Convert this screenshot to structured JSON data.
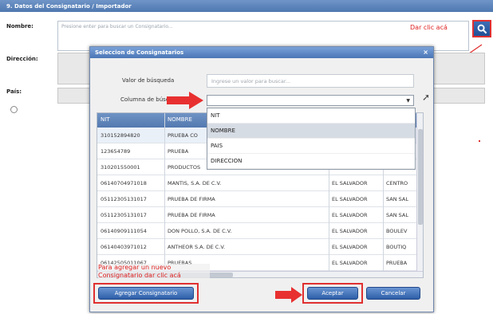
{
  "section": {
    "title": "9. Datos del Consignatario / Importador"
  },
  "form": {
    "nombre_label": "Nombre:",
    "nombre_placeholder": "Presione enter para buscar un Consignatario...",
    "direccion_label": "Dirección:",
    "pais_label": "País:"
  },
  "annotations": {
    "click_here": "Dar clic acá",
    "add_new": "Para agregar un nuevo Consignatario dar clic acá"
  },
  "modal": {
    "title": "Seleccion de Consignatarios",
    "close_glyph": "×",
    "valor_label": "Valor de búsqueda",
    "valor_placeholder": "Ingrese un valor para buscar...",
    "columna_label": "Columna de búsqueda",
    "dropdown_options": [
      "NIT",
      "NOMBRE",
      "PAIS",
      "DIRECCION"
    ],
    "grid": {
      "headers": [
        "NIT",
        "NOMBRE",
        "",
        ""
      ],
      "rows": [
        [
          "310152894820",
          "PRUEBA CO",
          "",
          ""
        ],
        [
          "123654789",
          "PRUEBA",
          "",
          ""
        ],
        [
          "310201550001",
          "PRODUCTOS",
          "",
          ""
        ],
        [
          "06140704971018",
          "MANTIS, S.A. DE C.V.",
          "EL SALVADOR",
          "CENTRO"
        ],
        [
          "05112305131017",
          "PRUEBA DE FIRMA",
          "EL SALVADOR",
          "SAN SAL"
        ],
        [
          "05112305131017",
          "PRUEBA DE FIRMA",
          "EL SALVADOR",
          "SAN SAL"
        ],
        [
          "06140909111054",
          "DON POLLO, S.A. DE C.V.",
          "EL SALVADOR",
          "BOULEV"
        ],
        [
          "06140403971012",
          "ANTHEOR S.A. DE C.V.",
          "EL SALVADOR",
          "BOUTIQ"
        ],
        [
          "06142505011067",
          "PRUEBAS",
          "EL SALVADOR",
          "PRUEBA"
        ]
      ]
    },
    "buttons": {
      "agregar": "Agregar Consignatario",
      "aceptar": "Aceptar",
      "cancelar": "Cancelar"
    }
  },
  "icons": {
    "search": "search-icon",
    "cursor": "pointer-cursor-icon"
  },
  "colors": {
    "accent": "#3f6fb6",
    "annotation": "#e03030"
  }
}
